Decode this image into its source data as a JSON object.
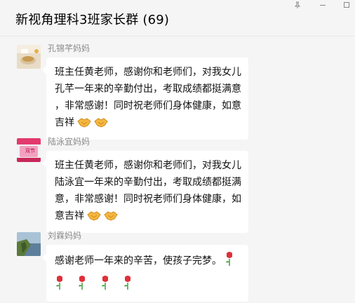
{
  "chat": {
    "title": "新视角理科3班家长群 (69)"
  },
  "window_controls": [
    {
      "name": "pin-icon"
    },
    {
      "name": "minimize-icon"
    },
    {
      "name": "maximize-icon"
    }
  ],
  "messages": [
    {
      "sender": "孔锦芊妈妈",
      "avatar_icon": "tea-cup-photo",
      "lines": [
        "班主任黄老师，感谢你和老师们，对我女儿",
        "孔芊一年来的辛勤付出，考取成绩都挺满意",
        "，非常感谢！同时祝老师们身体健康，如意",
        "吉祥"
      ],
      "emojis": [
        "handshake",
        "handshake"
      ]
    },
    {
      "sender": "陆泳宜妈妈",
      "avatar_icon": "promo-banner",
      "avatar_text": "双节",
      "lines": [
        "班主任黄老师，感谢你和老师们，对我女儿",
        "陆泳宜一年来的辛勤付出，考取成绩都挺满",
        "意，非常感谢！同时祝老师们身体健康，如",
        "意吉祥"
      ],
      "emojis": [
        "handshake",
        "handshake"
      ]
    },
    {
      "sender": "刘霖妈妈",
      "avatar_icon": "coastline-photo",
      "lines": [
        "感谢老师一年来的辛苦，使孩子完梦。",
        ""
      ],
      "emojis": [
        "rose",
        "rose",
        "rose",
        "rose",
        "rose"
      ]
    }
  ],
  "colors": {
    "background": "#f5f5f5",
    "bubble": "#ffffff",
    "sender": "#8b8b8b",
    "handshake": "#f5b740",
    "rose": "#e0303a",
    "stem": "#3f9b3a"
  }
}
